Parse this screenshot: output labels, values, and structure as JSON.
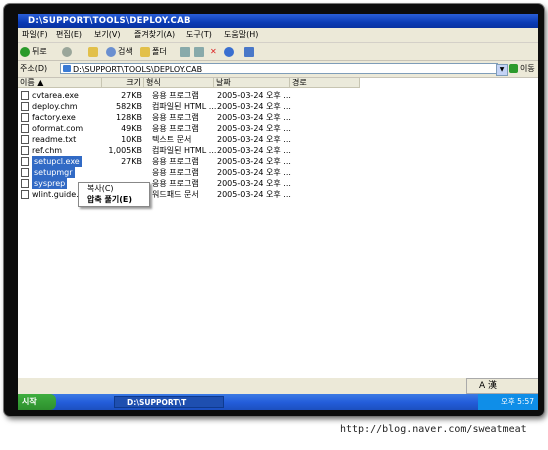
{
  "window": {
    "title": "D:\\SUPPORT\\TOOLS\\DEPLOY.CAB"
  },
  "menubar": [
    "파일(F)",
    "편집(E)",
    "보기(V)",
    "즐겨찾기(A)",
    "도구(T)",
    "도움말(H)"
  ],
  "toolbar": {
    "back": "뒤로",
    "search": "검색",
    "folders": "폴더"
  },
  "address": {
    "label": "주소(D)",
    "value": "D:\\SUPPORT\\TOOLS\\DEPLOY.CAB",
    "go": "이동"
  },
  "columns": [
    "이름",
    "크기",
    "형식",
    "날짜",
    "경로"
  ],
  "files": [
    {
      "name": "cvtarea.exe",
      "size": "27KB",
      "type": "응용 프로그램",
      "date": "2005-03-24 오후 ..."
    },
    {
      "name": "deploy.chm",
      "size": "582KB",
      "type": "컴파일된 HTML ...",
      "date": "2005-03-24 오후 ..."
    },
    {
      "name": "factory.exe",
      "size": "128KB",
      "type": "응용 프로그램",
      "date": "2005-03-24 오후 ..."
    },
    {
      "name": "oformat.com",
      "size": "49KB",
      "type": "응용 프로그램",
      "date": "2005-03-24 오후 ..."
    },
    {
      "name": "readme.txt",
      "size": "10KB",
      "type": "텍스트 문서",
      "date": "2005-03-24 오후 ..."
    },
    {
      "name": "ref.chm",
      "size": "1,005KB",
      "type": "컴파일된 HTML ...",
      "date": "2005-03-24 오후 ..."
    },
    {
      "name": "setupcl.exe",
      "size": "27KB",
      "type": "응용 프로그램",
      "date": "2005-03-24 오후 ..."
    },
    {
      "name": "setupmgr",
      "size": "",
      "type": "응용 프로그램",
      "date": "2005-03-24 오후 ..."
    },
    {
      "name": "sysprep",
      "size": "",
      "type": "응용 프로그램",
      "date": "2005-03-24 오후 ..."
    },
    {
      "name": "wlint.guide.doc",
      "size": "",
      "type": "워드패드 문서",
      "date": "2005-03-24 오후 ..."
    }
  ],
  "context_menu": {
    "copy": "복사(C)",
    "extract": "압축 풀기(E)"
  },
  "ime": {
    "mode": "A 漢"
  },
  "taskbar": {
    "start": "시작",
    "task": "D:\\SUPPORT\\T",
    "clock": "오후 5:57"
  },
  "watermark": "http://blog.naver.com/sweatmeat"
}
